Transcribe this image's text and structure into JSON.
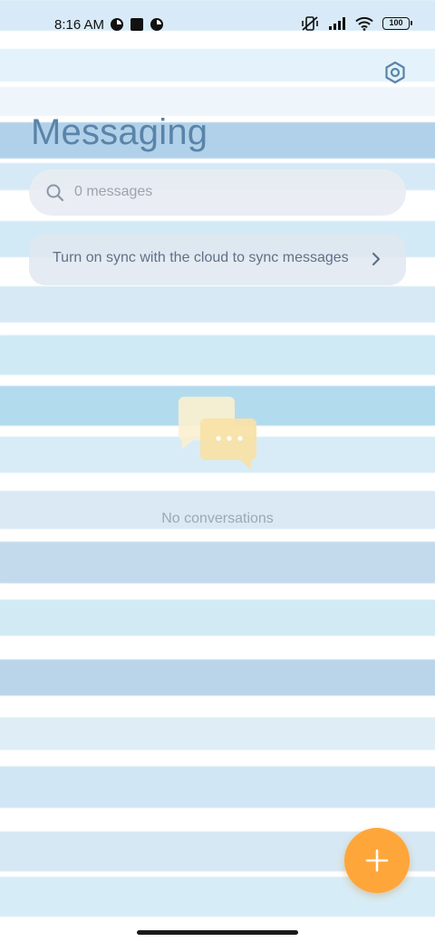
{
  "status_bar": {
    "time": "8:16 AM",
    "battery": "100"
  },
  "header": {
    "title": "Messaging",
    "settings_icon": "settings-icon"
  },
  "search": {
    "placeholder": "0 messages"
  },
  "sync_banner": {
    "text": "Turn on sync with the cloud to sync messages"
  },
  "empty_state": {
    "text": "No conversations"
  },
  "fab": {
    "icon": "plus-icon",
    "color": "#ffa63a"
  },
  "colors": {
    "title": "#5a84a8",
    "accent": "#ffa63a"
  }
}
